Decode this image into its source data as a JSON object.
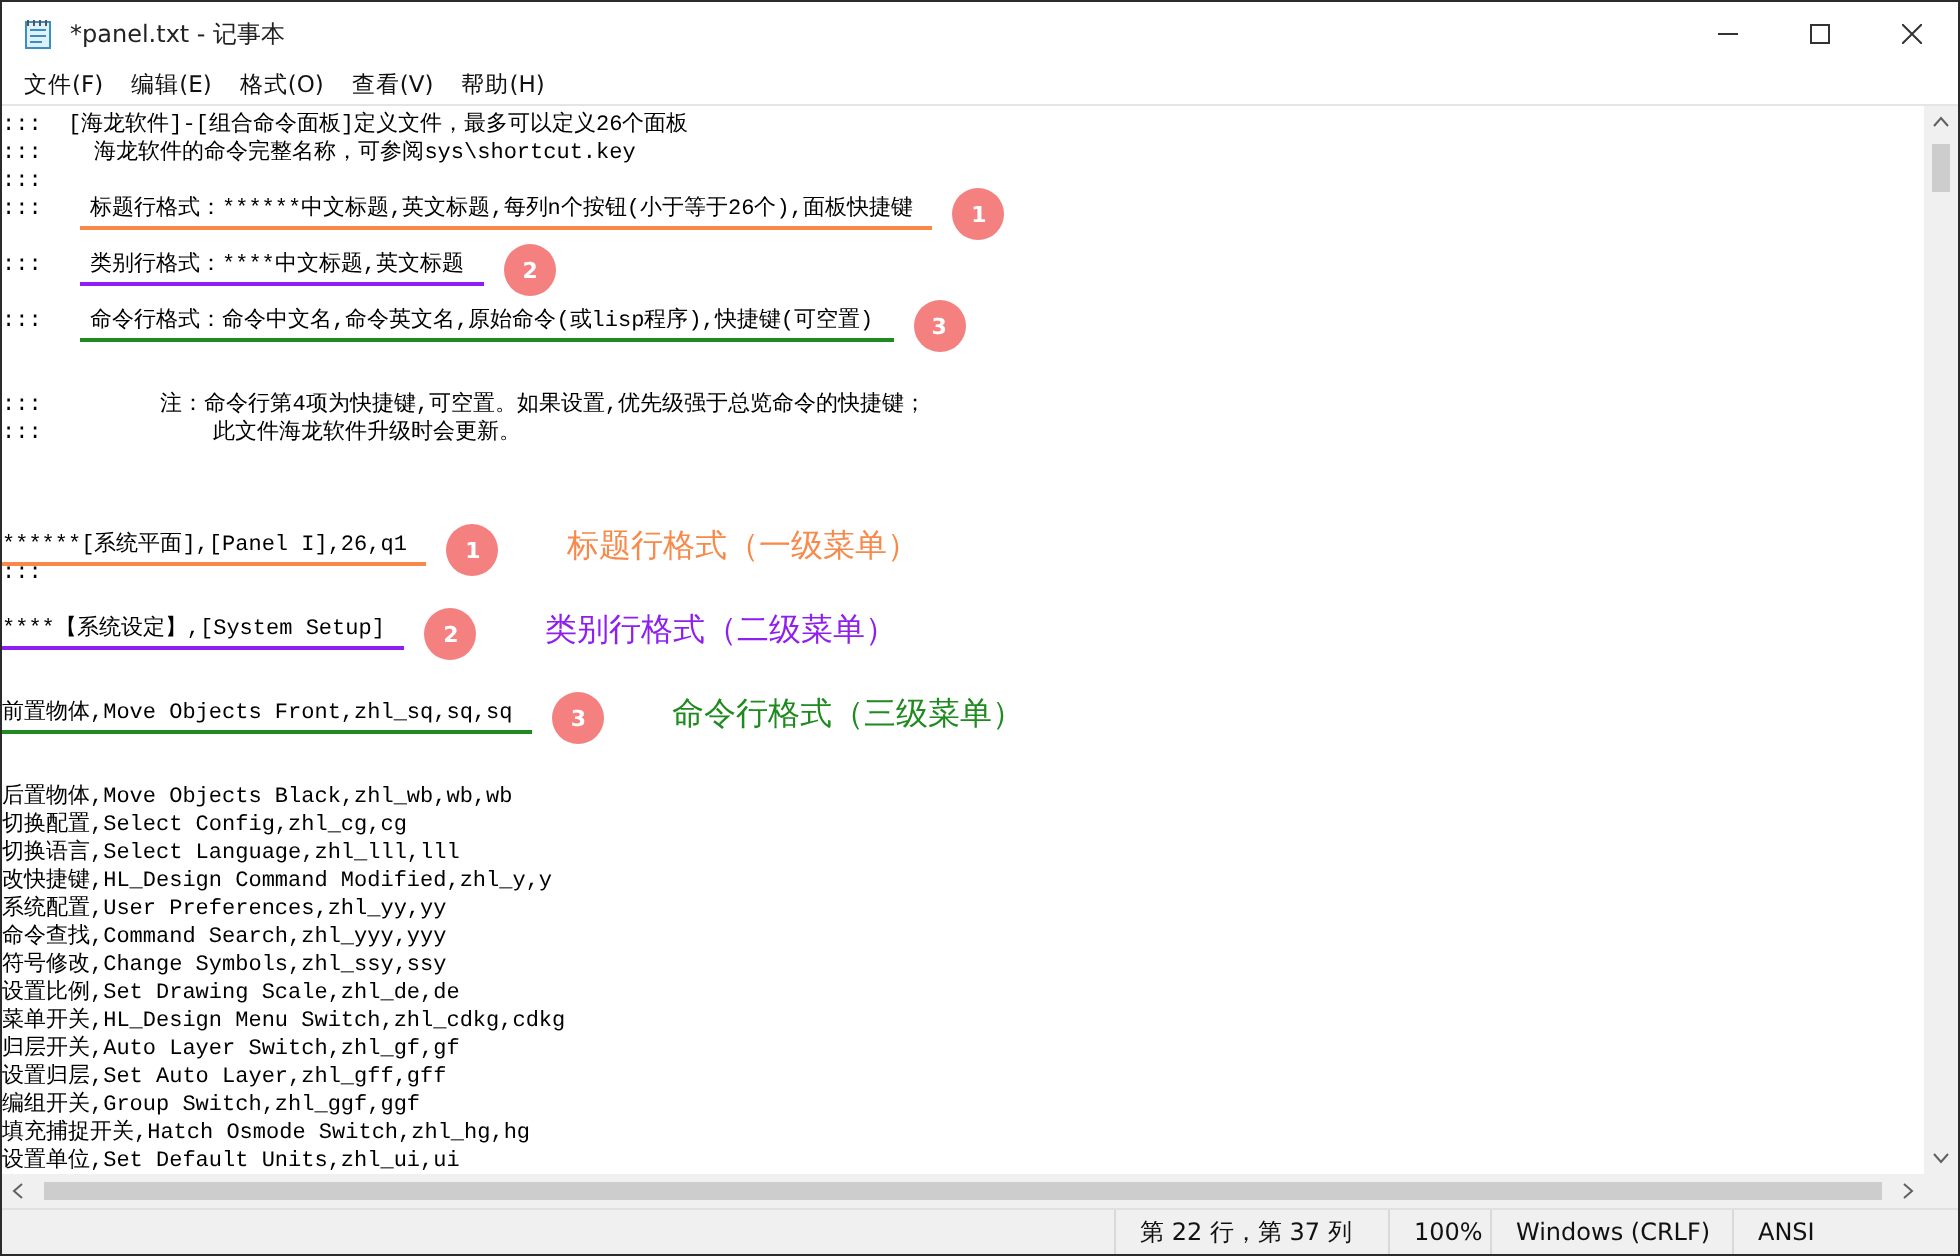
{
  "window": {
    "title": "*panel.txt - 记事本"
  },
  "menu": [
    "文件(F)",
    "编辑(E)",
    "格式(O)",
    "查看(V)",
    "帮助(H)"
  ],
  "lines": [
    {
      "kind": "text",
      "text": ":::  [海龙软件]-[组合命令面板]定义文件，最多可以定义26个面板"
    },
    {
      "kind": "text",
      "text": ":::    海龙软件的命令完整名称，可参阅sys\\shortcut.key"
    },
    {
      "kind": "text",
      "text": ":::"
    },
    {
      "kind": "marked",
      "prefix": ":::",
      "text": "标题行格式：******中文标题,英文标题,每列n个按钮(小于等于26个),面板快捷键",
      "marker": "1",
      "color": "#f7894a"
    },
    {
      "kind": "blank"
    },
    {
      "kind": "marked",
      "prefix": ":::",
      "text": "类别行格式：****中文标题,英文标题",
      "marker": "2",
      "color": "#8f1ff0"
    },
    {
      "kind": "blank"
    },
    {
      "kind": "marked",
      "prefix": ":::",
      "text": "命令行格式：命令中文名,命令英文名,原始命令(或lisp程序),快捷键(可空置)",
      "marker": "3",
      "color": "#1f8a1f"
    },
    {
      "kind": "blank"
    },
    {
      "kind": "blank"
    },
    {
      "kind": "text",
      "text": ":::         注：命令行第4项为快捷键,可空置。如果设置,优先级强于总览命令的快捷键；"
    },
    {
      "kind": "text",
      "text": ":::             此文件海龙软件升级时会更新。"
    },
    {
      "kind": "blank"
    },
    {
      "kind": "blank"
    },
    {
      "kind": "blank"
    },
    {
      "kind": "marked",
      "text": "******[系统平面],[Panel I],26,q1",
      "marker": "1",
      "color": "#f7894a",
      "label": "标题行格式（一级菜单）"
    },
    {
      "kind": "text",
      "text": ":::"
    },
    {
      "kind": "blank"
    },
    {
      "kind": "marked",
      "text": "****【系统设定】,[System Setup]",
      "marker": "2",
      "color": "#8f1ff0",
      "label": "类别行格式（二级菜单）"
    },
    {
      "kind": "blank"
    },
    {
      "kind": "blank"
    },
    {
      "kind": "marked",
      "text": "前置物体,Move Objects Front,zhl_sq,sq,sq",
      "marker": "3",
      "color": "#1f8a1f",
      "label": "命令行格式（三级菜单）"
    },
    {
      "kind": "blank"
    },
    {
      "kind": "blank"
    },
    {
      "kind": "text",
      "text": "后置物体,Move Objects Black,zhl_wb,wb,wb"
    },
    {
      "kind": "text",
      "text": "切换配置,Select Config,zhl_cg,cg"
    },
    {
      "kind": "text",
      "text": "切换语言,Select Language,zhl_lll,lll"
    },
    {
      "kind": "text",
      "text": "改快捷键,HL_Design Command Modified,zhl_y,y"
    },
    {
      "kind": "text",
      "text": "系统配置,User Preferences,zhl_yy,yy"
    },
    {
      "kind": "text",
      "text": "命令查找,Command Search,zhl_yyy,yyy"
    },
    {
      "kind": "text",
      "text": "符号修改,Change Symbols,zhl_ssy,ssy"
    },
    {
      "kind": "text",
      "text": "设置比例,Set Drawing Scale,zhl_de,de"
    },
    {
      "kind": "text",
      "text": "菜单开关,HL_Design Menu Switch,zhl_cdkg,cdkg"
    },
    {
      "kind": "text",
      "text": "归层开关,Auto Layer Switch,zhl_gf,gf"
    },
    {
      "kind": "text",
      "text": "设置归层,Set Auto Layer,zhl_gff,gff"
    },
    {
      "kind": "text",
      "text": "编组开关,Group Switch,zhl_ggf,ggf"
    },
    {
      "kind": "text",
      "text": "填充捕捉开关,Hatch Osmode Switch,zhl_hg,hg"
    },
    {
      "kind": "text",
      "text": "设置单位,Set Default Units,zhl_ui,ui"
    }
  ],
  "status_bar": {
    "position": "第 22 行，第 37 列",
    "zoom": "100%",
    "line_ending": "Windows (CRLF)",
    "encoding": "ANSI"
  }
}
